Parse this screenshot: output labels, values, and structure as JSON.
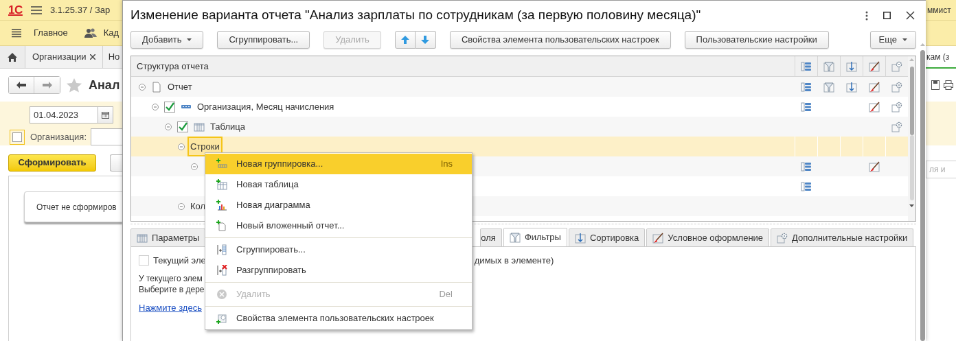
{
  "app": {
    "logo": "1С",
    "version": "3.1.25.37 / Зар",
    "user": "ммист",
    "sections": [
      {
        "label": "Главное"
      },
      {
        "label": "Кад"
      }
    ],
    "tabs": [
      {
        "label": "Организации",
        "closable": true,
        "selected": false
      },
      {
        "label": "Но",
        "selected": false
      },
      {
        "label": "кам (з",
        "selected": true
      }
    ],
    "form": {
      "title": "Анал",
      "date": "01.04.2023",
      "org_checked": false,
      "org_label": "Организация:",
      "generate": "Сформировать",
      "message": "Отчет не сформиров",
      "search_placeholder": "ля и"
    }
  },
  "dialog": {
    "title": "Изменение варианта отчета \"Анализ зарплаты по сотрудникам (за первую половину месяца)\"",
    "toolbar": [
      {
        "kind": "dropdown",
        "label": "Добавить",
        "disabled": false
      },
      {
        "kind": "button",
        "label": "Сгруппировать...",
        "disabled": false
      },
      {
        "kind": "button",
        "label": "Удалить",
        "disabled": true
      },
      {
        "kind": "move"
      },
      {
        "kind": "button",
        "label": "Свойства элемента пользовательских настроек",
        "disabled": false
      },
      {
        "kind": "button",
        "label": "Пользовательские настройки",
        "disabled": false
      }
    ],
    "more": "Еще",
    "tree": {
      "header": "Структура отчета",
      "columns": [
        {
          "kind": "group"
        },
        {
          "kind": "filter"
        },
        {
          "kind": "sort"
        },
        {
          "kind": "conditional"
        },
        {
          "kind": "extra"
        }
      ],
      "nodes": [
        {
          "kind": "report",
          "label": "Отчет",
          "expanded": true,
          "selected": false,
          "settings": {
            "group": true,
            "filter": true,
            "sort": true,
            "conditional": true,
            "extra": true
          },
          "children": [
            {
              "kind": "grouping",
              "label": "Организация, Месяц начисления",
              "checked": true,
              "expanded": true,
              "selected": false,
              "settings": {
                "group": true,
                "filter": false,
                "sort": false,
                "conditional": true,
                "extra": true
              },
              "children": [
                {
                  "kind": "table",
                  "label": "Таблица",
                  "checked": true,
                  "expanded": true,
                  "selected": false,
                  "settings": {
                    "group": false,
                    "filter": false,
                    "sort": false,
                    "conditional": false,
                    "extra": true
                  },
                  "children": [
                    {
                      "label": "Строки",
                      "expanded": true,
                      "selected": true,
                      "children": [
                        {
                          "expanded": true,
                          "selected": false,
                          "settings": {
                            "group": true,
                            "filter": false,
                            "sort": false,
                            "conditional": true,
                            "extra": false
                          },
                          "children": [
                            {
                              "selected": false,
                              "settings": {
                                "group": true,
                                "filter": false,
                                "sort": false,
                                "conditional": false,
                                "extra": false
                              }
                            }
                          ]
                        }
                      ]
                    },
                    {
                      "label": "Кол",
                      "expanded": true,
                      "selected": false
                    }
                  ]
                }
              ]
            }
          ]
        }
      ]
    },
    "tabs": [
      {
        "label": "Параметры",
        "selected": false
      },
      {
        "label": "оля",
        "selected": false
      },
      {
        "label": "Фильтры",
        "selected": true
      },
      {
        "label": "Сортировка",
        "selected": false
      },
      {
        "label": "Условное оформление",
        "selected": false
      },
      {
        "label": "Дополнительные настройки",
        "selected": false
      }
    ],
    "current_only": {
      "checked": false,
      "label_start": "Текущий эле",
      "label_end": "димых в элементе)"
    },
    "notes": [
      "У текущего элем",
      "Выберите в дере"
    ],
    "link": "Нажмите здесь",
    "menu": {
      "groups": [
        {
          "items": [
            {
              "kind": "command",
              "label": "Новая группировка...",
              "shortcut": "Ins",
              "selected": true
            },
            {
              "kind": "command",
              "label": "Новая таблица",
              "selected": false
            },
            {
              "kind": "command",
              "label": "Новая диаграмма",
              "selected": false
            },
            {
              "kind": "command",
              "label": "Новый вложенный отчет...",
              "selected": false
            }
          ]
        },
        {
          "items": [
            {
              "kind": "command",
              "label": "Сгруппировать...",
              "selected": false
            },
            {
              "kind": "command",
              "label": "Разгруппировать",
              "selected": false
            }
          ]
        },
        {
          "items": [
            {
              "kind": "unavailable",
              "label": "Удалить",
              "shortcut": "Del",
              "selected": false
            }
          ]
        },
        {
          "items": [
            {
              "kind": "command",
              "label": "Свойства элемента пользовательских настроек",
              "selected": false
            }
          ]
        }
      ]
    }
  }
}
